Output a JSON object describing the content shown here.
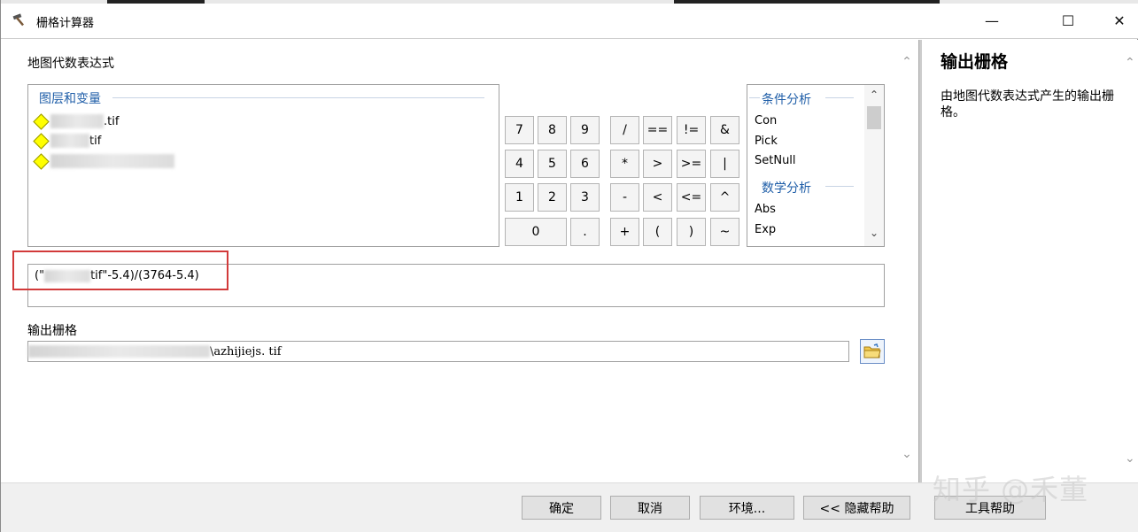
{
  "window": {
    "title": "栅格计算器",
    "icon": "hammer-icon",
    "controls": {
      "minimize": "—",
      "maximize": "☐",
      "close": "✕"
    }
  },
  "main": {
    "expression_label": "地图代数表达式",
    "layers": {
      "header": "图层和变量",
      "items": [
        {
          "label": ".tif"
        },
        {
          "label": "tif"
        },
        {
          "label": ""
        }
      ]
    },
    "keypad": {
      "rows": [
        [
          "7",
          "8",
          "9",
          "/",
          "==",
          "!=",
          "&"
        ],
        [
          "4",
          "5",
          "6",
          "*",
          ">",
          ">=",
          "|"
        ],
        [
          "1",
          "2",
          "3",
          "-",
          "<",
          "<=",
          "^"
        ],
        [
          "0",
          ".",
          "+",
          "(",
          ")",
          "~"
        ]
      ]
    },
    "functions": {
      "groups": [
        {
          "header": "条件分析",
          "items": [
            "Con",
            "Pick",
            "SetNull"
          ]
        },
        {
          "header": "数学分析",
          "items": [
            "Abs",
            "Exp"
          ]
        }
      ]
    },
    "expression": {
      "prefix": "(\"",
      "suffix": "tif\"-5.4)/(3764-5.4)"
    },
    "output_label": "输出栅格",
    "output_path_suffix": "\\azhijiejs. tif"
  },
  "help": {
    "title": "输出栅格",
    "body": "由地图代数表达式产生的输出栅格。"
  },
  "buttons": {
    "ok": "确定",
    "cancel": "取消",
    "environments": "环境...",
    "hide_help": "<< 隐藏帮助",
    "tool_help": "工具帮助"
  },
  "watermark": "知乎 @禾董",
  "colors": {
    "accent_blue": "#1f5ea8",
    "highlight_red": "#d23a3a",
    "layer_diamond": "#ffff00"
  }
}
